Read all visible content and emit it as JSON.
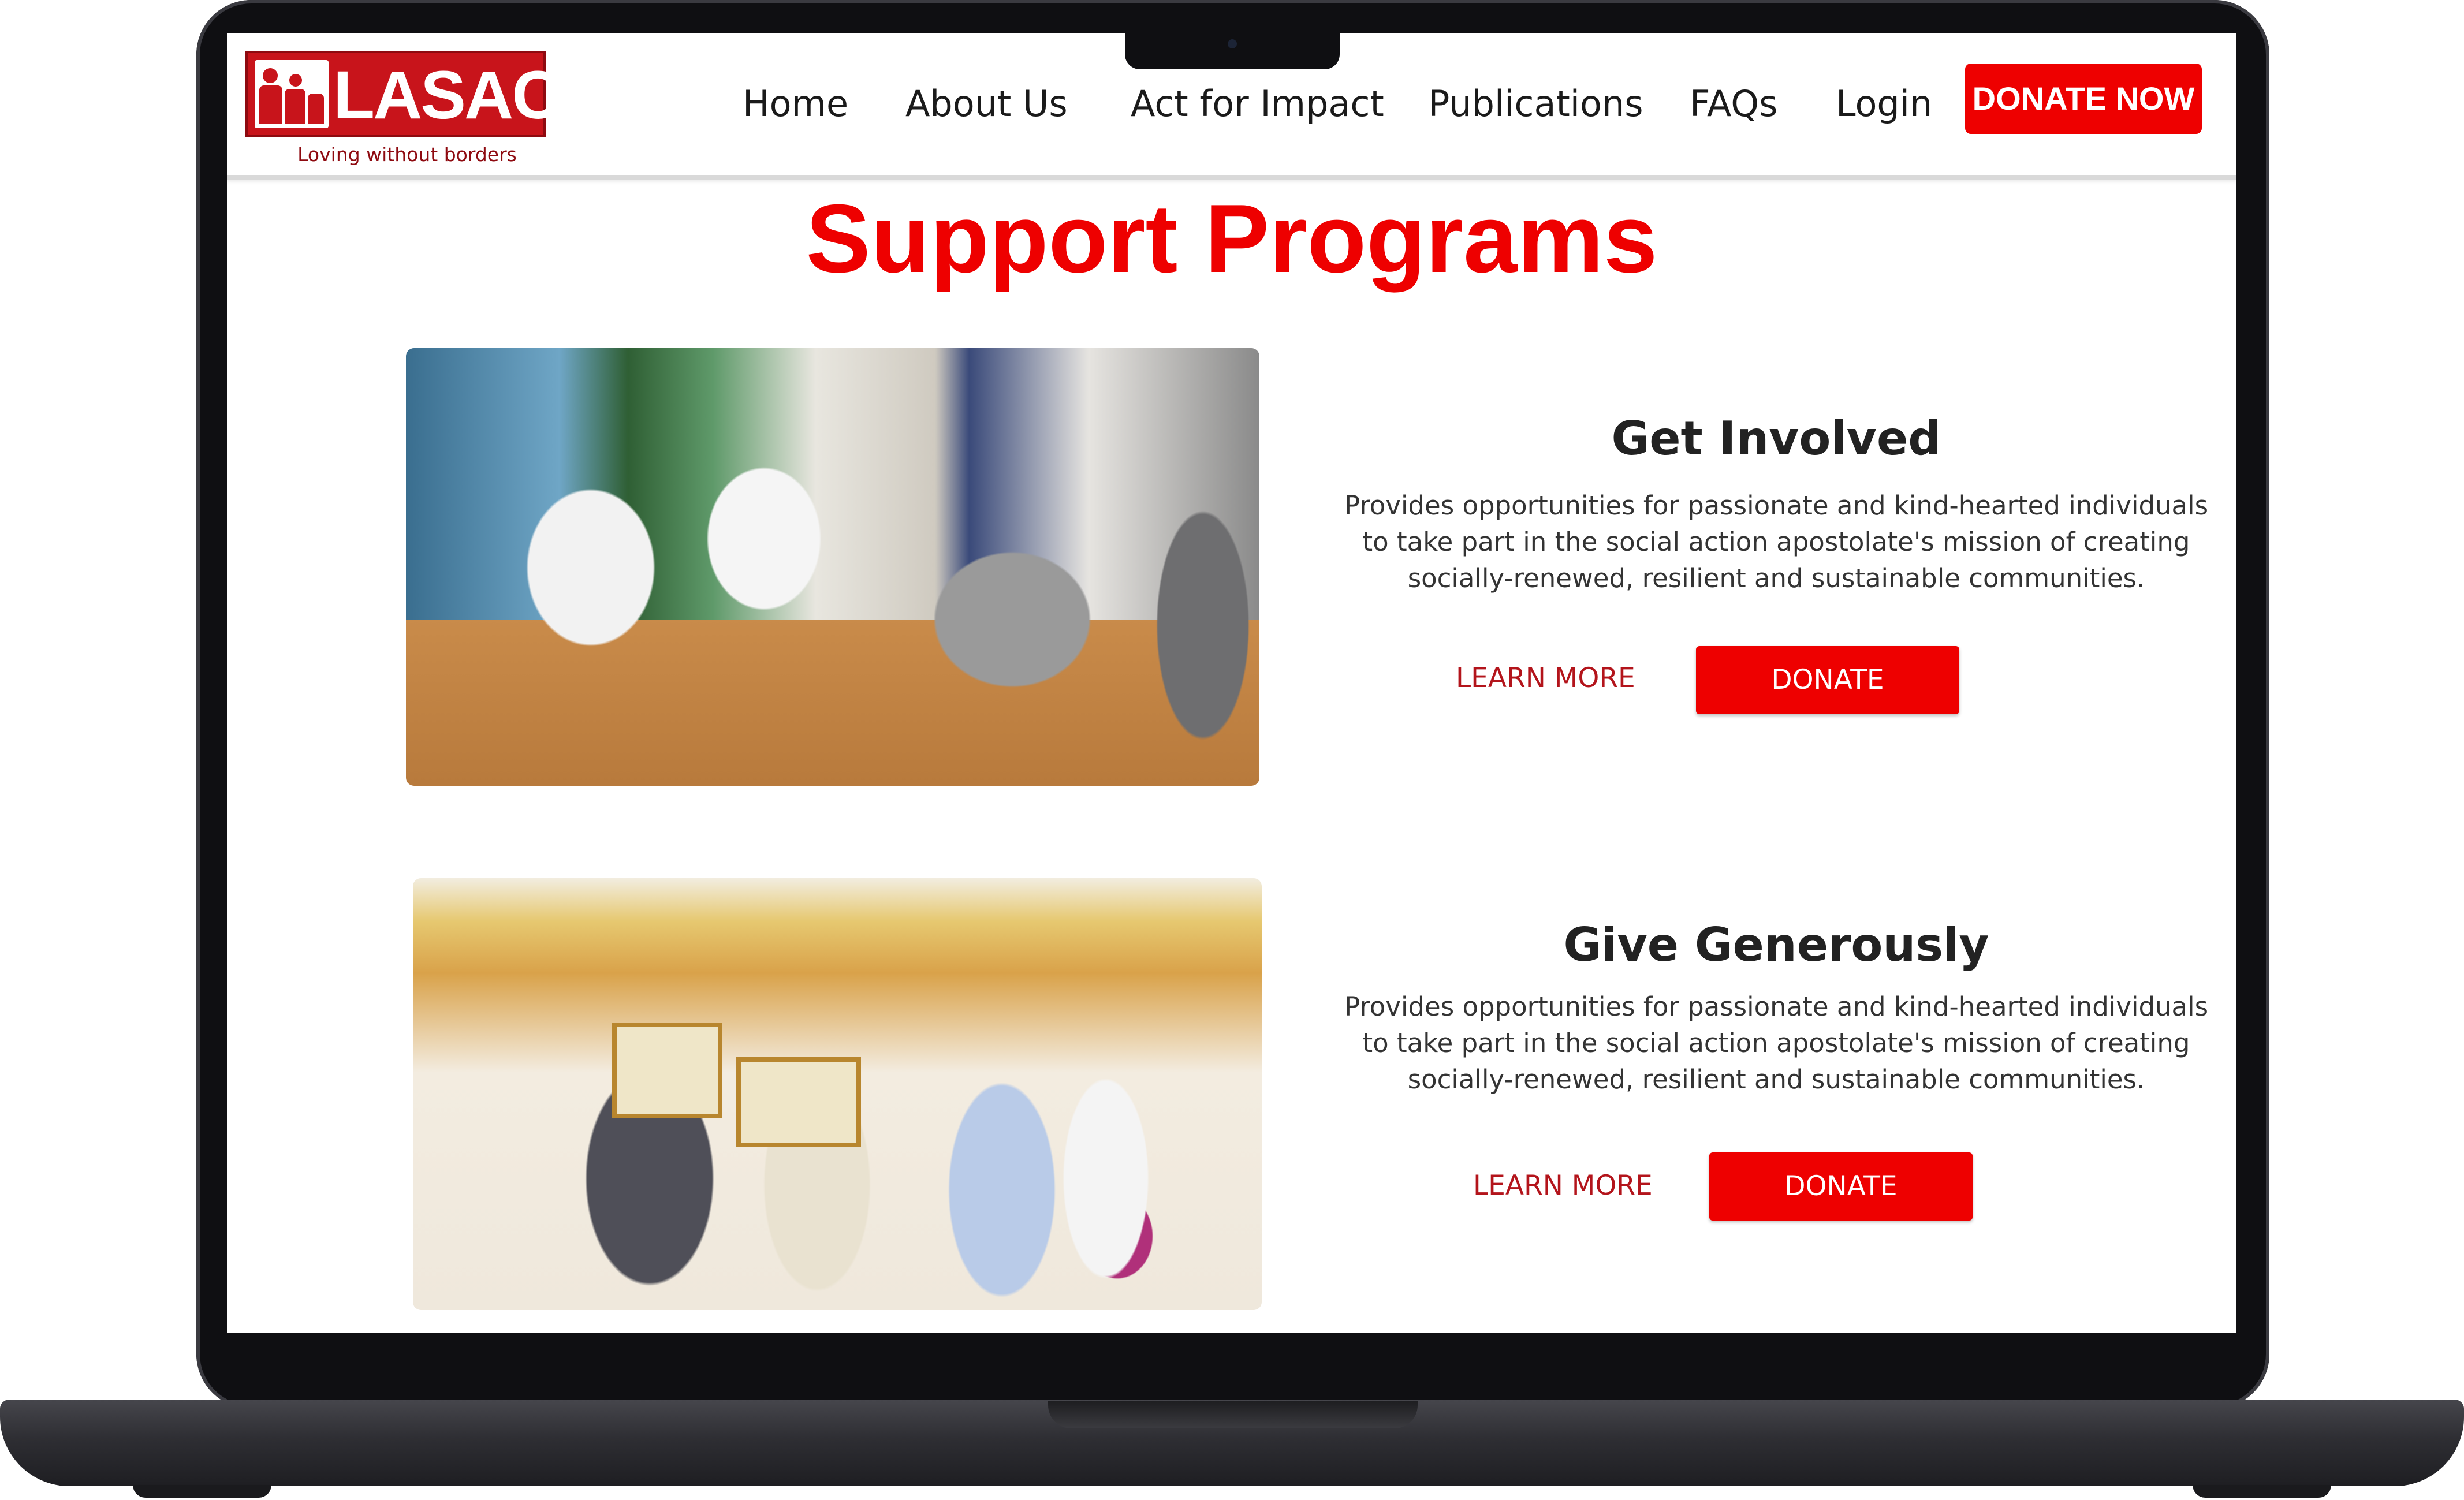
{
  "brand": {
    "name": "LASAC",
    "tagline": "Loving without borders",
    "primary_color": "#ee0000",
    "dark_red": "#b3141b"
  },
  "nav": {
    "items": [
      {
        "label": "Home"
      },
      {
        "label": "About Us"
      },
      {
        "label": "Act for Impact"
      },
      {
        "label": "Publications"
      },
      {
        "label": "FAQs"
      },
      {
        "label": "Login"
      }
    ],
    "donate_now": "DONATE NOW"
  },
  "page": {
    "title": "Support Programs"
  },
  "programs": [
    {
      "heading": "Get Involved",
      "description_lines": [
        "Provides opportunities for passionate and kind-hearted individuals",
        "to take part in the social action apostolate's mission of creating",
        "socially-renewed, resilient and sustainable communities."
      ],
      "learn_more": "LEARN MORE",
      "donate": "DONATE"
    },
    {
      "heading": "Give Generously",
      "description_lines": [
        "Provides opportunities for passionate and kind-hearted individuals",
        "to take part in the social action apostolate's mission of creating",
        "socially-renewed, resilient and sustainable communities."
      ],
      "learn_more": "LEARN MORE",
      "donate": "DONATE"
    }
  ]
}
